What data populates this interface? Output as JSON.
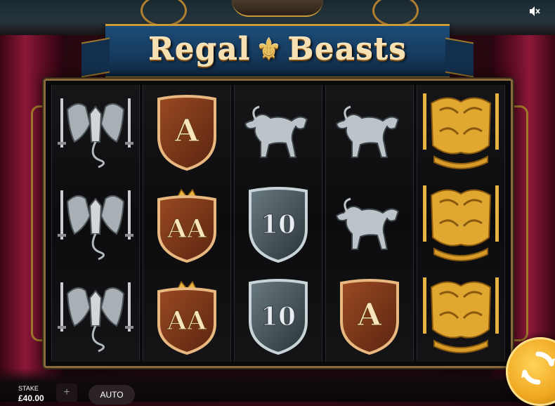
{
  "game": {
    "title_word1": "Regal",
    "title_word2": "Beasts",
    "title_emblem_icon": "fleur-de-lis-icon",
    "sound_icon": "speaker-muted-icon"
  },
  "reels": [
    [
      "griffin-pair",
      "griffin-pair",
      "griffin-pair"
    ],
    [
      "A",
      "AA",
      "AA"
    ],
    [
      "lion",
      "10",
      "10"
    ],
    [
      "lion",
      "lion",
      "A"
    ],
    [
      "gold-lion-crest",
      "gold-lion-crest",
      "gold-lion-crest"
    ]
  ],
  "controls": {
    "stake_label": "STAKE",
    "stake_value": "£40.00",
    "plus_label": "+",
    "auto_label": "AUTO",
    "spin_icon": "spin-arrows-icon"
  },
  "colors": {
    "gold": "#e8c060",
    "banner_blue": "#1d4c78",
    "curtain_red": "#8c1838",
    "spin_orange": "#f0a820"
  }
}
